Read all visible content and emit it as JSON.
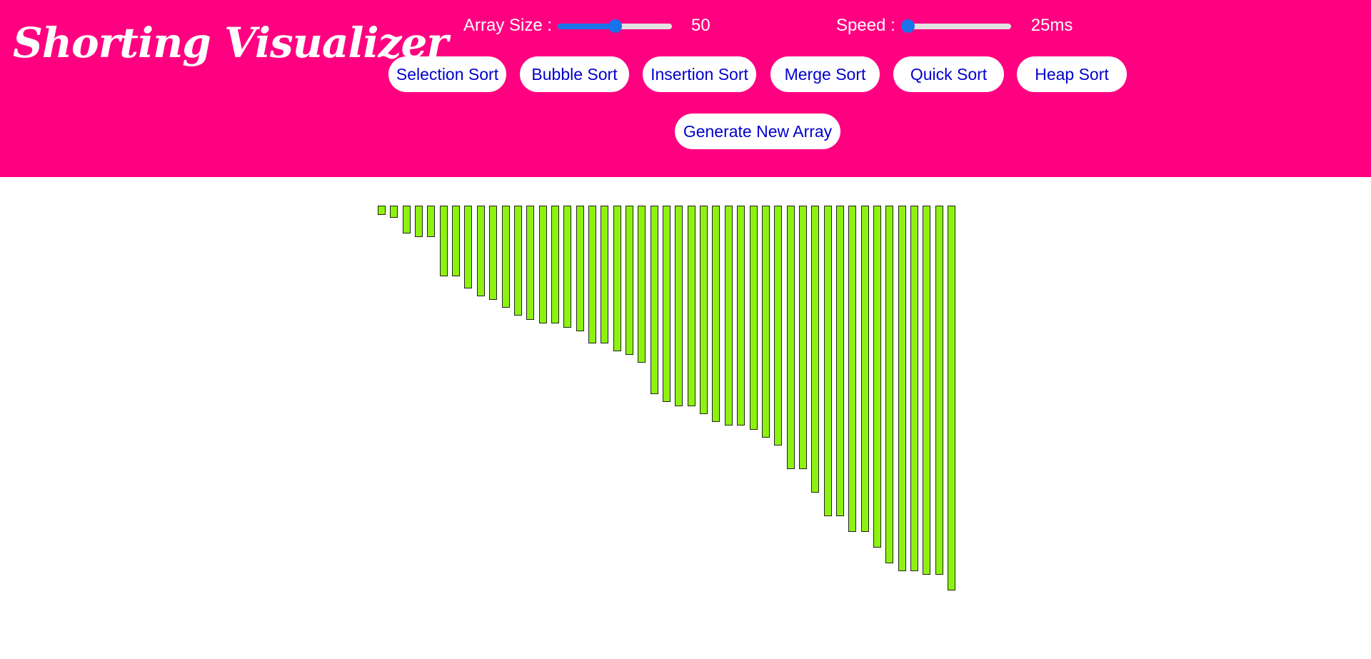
{
  "app": {
    "title": "Shorting Visualizer"
  },
  "controls": {
    "array_size": {
      "label": "Array Size :",
      "value": "50",
      "fraction": 0.5
    },
    "speed": {
      "label": "Speed :",
      "value": "25ms",
      "fraction": 0.0
    }
  },
  "buttons": {
    "selection_sort": "Selection Sort",
    "bubble_sort": "Bubble Sort",
    "insertion_sort": "Insertion Sort",
    "merge_sort": "Merge Sort",
    "quick_sort": "Quick Sort",
    "heap_sort": "Heap Sort",
    "generate_new_array": "Generate New Array"
  },
  "colors": {
    "header_bg": "#ff0080",
    "bar_fill": "#8ef211",
    "button_text": "#0000cc",
    "slider_accent": "#1a73e8"
  },
  "array": [
    1,
    3,
    7,
    8,
    8,
    18,
    18,
    21,
    23,
    24,
    26,
    28,
    29,
    30,
    30,
    31,
    32,
    35,
    35,
    37,
    38,
    40,
    48,
    50,
    51,
    51,
    53,
    55,
    56,
    56,
    57,
    59,
    61,
    67,
    67,
    73,
    79,
    79,
    83,
    83,
    87,
    91,
    93,
    93,
    94,
    94,
    98
  ]
}
